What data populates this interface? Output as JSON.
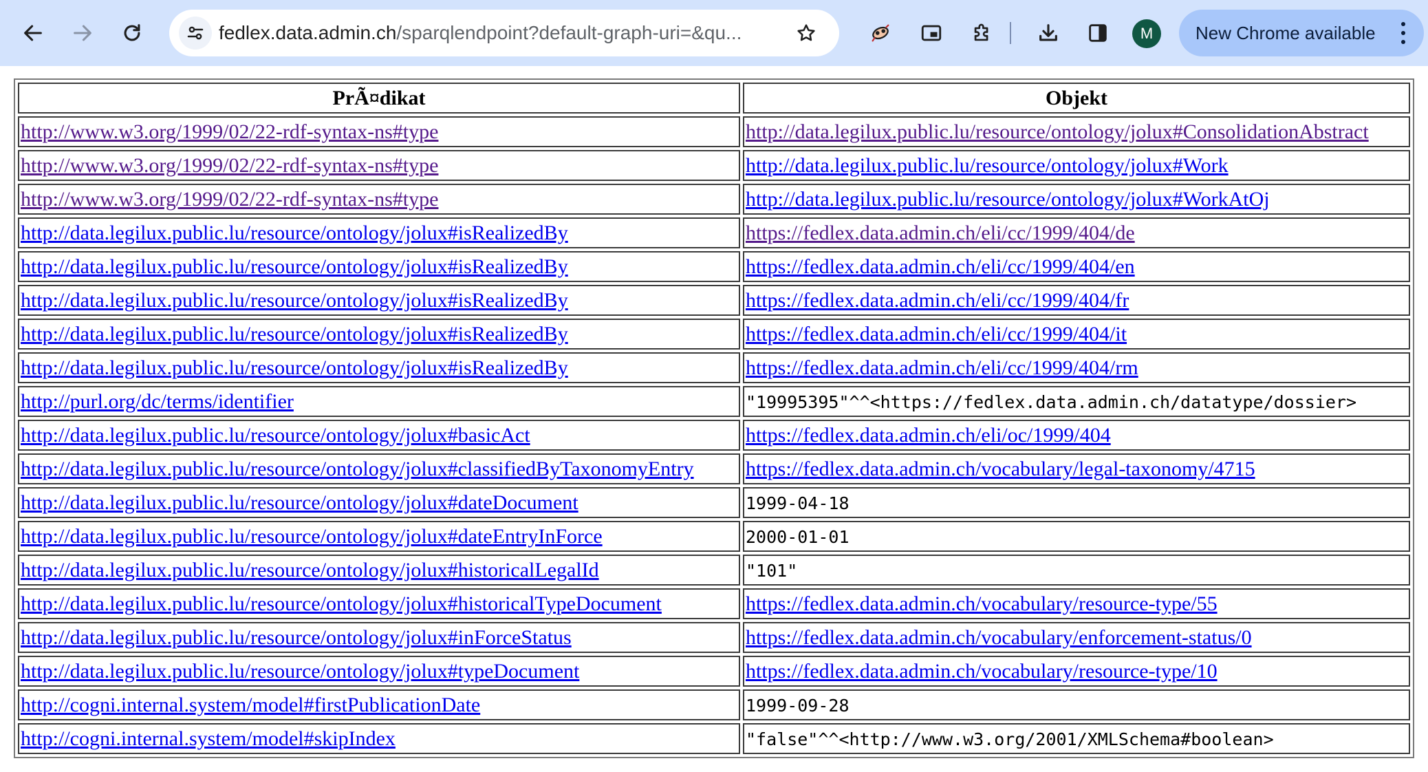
{
  "browser": {
    "url_host": "fedlex.data.admin.ch",
    "url_path": "/sparqlendpoint?default-graph-uri=&qu...",
    "profile_initial": "M",
    "update_label": "New Chrome available",
    "colors": {
      "toolbar": "#d3e3fd",
      "chip": "#a8c7fa",
      "avatar": "#0f5743"
    }
  },
  "table": {
    "headers": [
      "PrÃ¤dikat",
      "Objekt"
    ],
    "rows": [
      {
        "p": "http://www.w3.org/1999/02/22-rdf-syntax-ns#type",
        "o": "http://data.legilux.public.lu/resource/ontology/jolux#ConsolidationAbstract"
      },
      {
        "p": "http://www.w3.org/1999/02/22-rdf-syntax-ns#type",
        "o": "http://data.legilux.public.lu/resource/ontology/jolux#Work"
      },
      {
        "p": "http://www.w3.org/1999/02/22-rdf-syntax-ns#type",
        "o": "http://data.legilux.public.lu/resource/ontology/jolux#WorkAtOj"
      },
      {
        "p": "http://data.legilux.public.lu/resource/ontology/jolux#isRealizedBy",
        "o": "https://fedlex.data.admin.ch/eli/cc/1999/404/de"
      },
      {
        "p": "http://data.legilux.public.lu/resource/ontology/jolux#isRealizedBy",
        "o": "https://fedlex.data.admin.ch/eli/cc/1999/404/en"
      },
      {
        "p": "http://data.legilux.public.lu/resource/ontology/jolux#isRealizedBy",
        "o": "https://fedlex.data.admin.ch/eli/cc/1999/404/fr"
      },
      {
        "p": "http://data.legilux.public.lu/resource/ontology/jolux#isRealizedBy",
        "o": "https://fedlex.data.admin.ch/eli/cc/1999/404/it"
      },
      {
        "p": "http://data.legilux.public.lu/resource/ontology/jolux#isRealizedBy",
        "o": "https://fedlex.data.admin.ch/eli/cc/1999/404/rm"
      },
      {
        "p": "http://purl.org/dc/terms/identifier",
        "o": "\"19995395\"^^<https://fedlex.data.admin.ch/datatype/dossier>"
      },
      {
        "p": "http://data.legilux.public.lu/resource/ontology/jolux#basicAct",
        "o": "https://fedlex.data.admin.ch/eli/oc/1999/404"
      },
      {
        "p": "http://data.legilux.public.lu/resource/ontology/jolux#classifiedByTaxonomyEntry",
        "o": "https://fedlex.data.admin.ch/vocabulary/legal-taxonomy/4715"
      },
      {
        "p": "http://data.legilux.public.lu/resource/ontology/jolux#dateDocument",
        "o": "1999-04-18"
      },
      {
        "p": "http://data.legilux.public.lu/resource/ontology/jolux#dateEntryInForce",
        "o": "2000-01-01"
      },
      {
        "p": "http://data.legilux.public.lu/resource/ontology/jolux#historicalLegalId",
        "o": "\"101\""
      },
      {
        "p": "http://data.legilux.public.lu/resource/ontology/jolux#historicalTypeDocument",
        "o": "https://fedlex.data.admin.ch/vocabulary/resource-type/55"
      },
      {
        "p": "http://data.legilux.public.lu/resource/ontology/jolux#inForceStatus",
        "o": "https://fedlex.data.admin.ch/vocabulary/enforcement-status/0"
      },
      {
        "p": "http://data.legilux.public.lu/resource/ontology/jolux#typeDocument",
        "o": "https://fedlex.data.admin.ch/vocabulary/resource-type/10"
      },
      {
        "p": "http://cogni.internal.system/model#firstPublicationDate",
        "o": "1999-09-28"
      },
      {
        "p": "http://cogni.internal.system/model#skipIndex",
        "o": "\"false\"^^<http://www.w3.org/2001/XMLSchema#boolean>"
      }
    ]
  }
}
